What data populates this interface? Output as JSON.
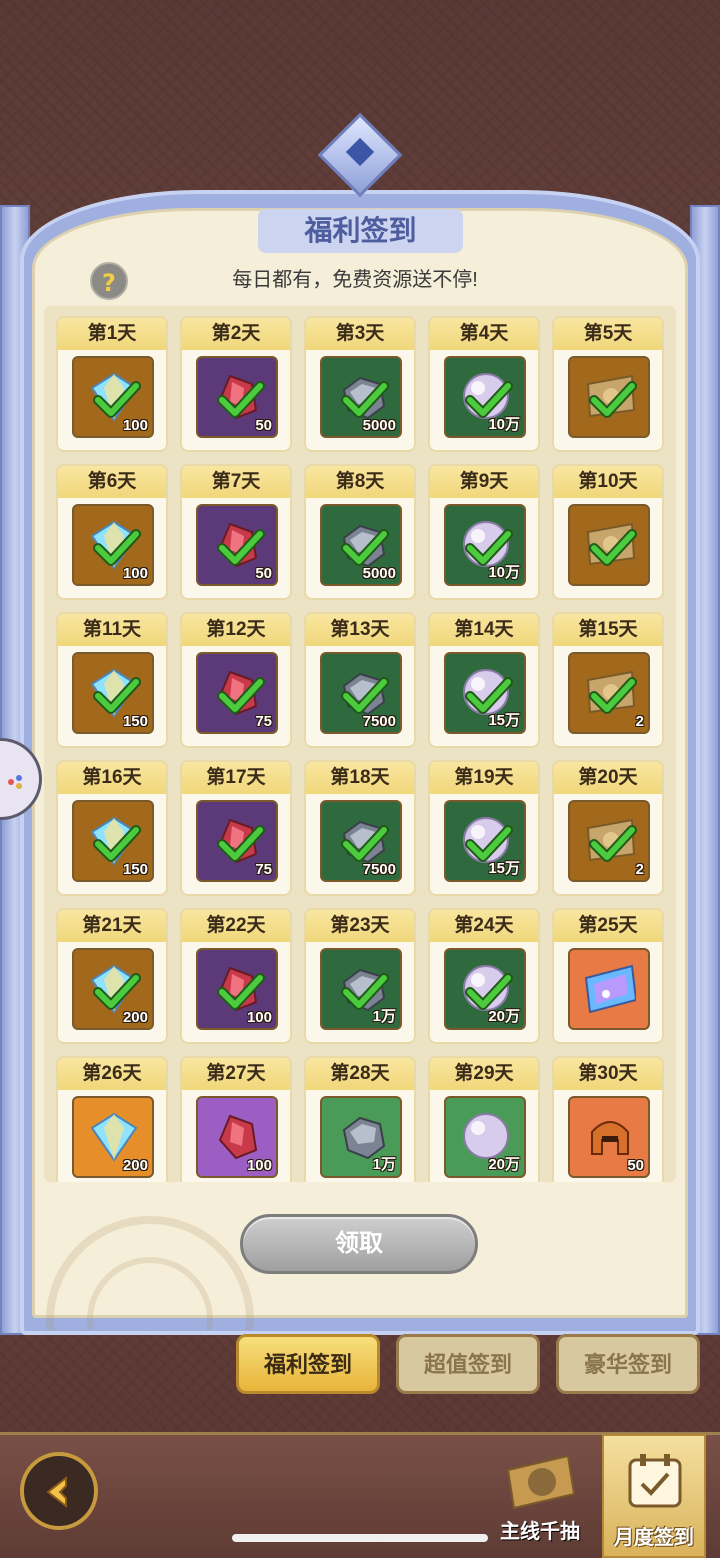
{
  "title": "福利签到",
  "subtitle": "每日都有，免费资源送不停!",
  "help_icon": "question-mark-icon",
  "help_symbol": "?",
  "days": [
    {
      "label": "第1天",
      "item": "diamond",
      "qty": "100",
      "claimed": true
    },
    {
      "label": "第2天",
      "item": "red-crystal",
      "qty": "50",
      "claimed": true
    },
    {
      "label": "第3天",
      "item": "ore",
      "qty": "5000",
      "claimed": true
    },
    {
      "label": "第4天",
      "item": "pearl",
      "qty": "10万",
      "claimed": true
    },
    {
      "label": "第5天",
      "item": "ticket",
      "qty": "",
      "claimed": true
    },
    {
      "label": "第6天",
      "item": "diamond",
      "qty": "100",
      "claimed": true
    },
    {
      "label": "第7天",
      "item": "red-crystal",
      "qty": "50",
      "claimed": true
    },
    {
      "label": "第8天",
      "item": "ore",
      "qty": "5000",
      "claimed": true
    },
    {
      "label": "第9天",
      "item": "pearl",
      "qty": "10万",
      "claimed": true
    },
    {
      "label": "第10天",
      "item": "ticket",
      "qty": "",
      "claimed": true
    },
    {
      "label": "第11天",
      "item": "diamond",
      "qty": "150",
      "claimed": true
    },
    {
      "label": "第12天",
      "item": "red-crystal",
      "qty": "75",
      "claimed": true
    },
    {
      "label": "第13天",
      "item": "ore",
      "qty": "7500",
      "claimed": true
    },
    {
      "label": "第14天",
      "item": "pearl",
      "qty": "15万",
      "claimed": true
    },
    {
      "label": "第15天",
      "item": "ticket",
      "qty": "2",
      "claimed": true
    },
    {
      "label": "第16天",
      "item": "diamond",
      "qty": "150",
      "claimed": true
    },
    {
      "label": "第17天",
      "item": "red-crystal",
      "qty": "75",
      "claimed": true
    },
    {
      "label": "第18天",
      "item": "ore",
      "qty": "7500",
      "claimed": true
    },
    {
      "label": "第19天",
      "item": "pearl",
      "qty": "15万",
      "claimed": true
    },
    {
      "label": "第20天",
      "item": "ticket",
      "qty": "2",
      "claimed": true
    },
    {
      "label": "第21天",
      "item": "diamond",
      "qty": "200",
      "claimed": true
    },
    {
      "label": "第22天",
      "item": "red-crystal",
      "qty": "100",
      "claimed": true
    },
    {
      "label": "第23天",
      "item": "ore",
      "qty": "1万",
      "claimed": true
    },
    {
      "label": "第24天",
      "item": "pearl",
      "qty": "20万",
      "claimed": true
    },
    {
      "label": "第25天",
      "item": "blue-ticket",
      "qty": "",
      "claimed": false
    },
    {
      "label": "第26天",
      "item": "diamond",
      "qty": "200",
      "claimed": false
    },
    {
      "label": "第27天",
      "item": "red-crystal",
      "qty": "100",
      "claimed": false
    },
    {
      "label": "第28天",
      "item": "ore",
      "qty": "1万",
      "claimed": false
    },
    {
      "label": "第29天",
      "item": "pearl",
      "qty": "20万",
      "claimed": false
    },
    {
      "label": "第30天",
      "item": "helmet",
      "qty": "50",
      "claimed": false
    }
  ],
  "claim_button": "领取",
  "tabs": [
    {
      "label": "福利签到",
      "active": true
    },
    {
      "label": "超值签到",
      "active": false
    },
    {
      "label": "豪华签到",
      "active": false
    }
  ],
  "bottom_nav": {
    "draw_label": "主线千抽",
    "month_label": "月度签到"
  },
  "colors": {
    "panel": "#f5eed9",
    "frame": "#9fb0e0",
    "check": "#4ccb3f",
    "accent": "#f0d77a"
  }
}
